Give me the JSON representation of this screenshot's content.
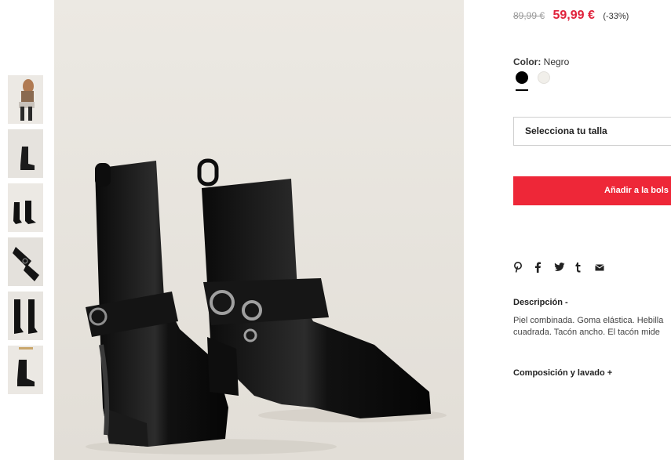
{
  "product": {
    "old_price": "89,99 €",
    "new_price": "59,99 €",
    "discount": "(-33%)",
    "color_label": "Color:",
    "color_value": "Negro",
    "swatches": [
      "Negro",
      "Blanco"
    ],
    "size_placeholder": "Selecciona tu talla",
    "add_to_bag": "Añadir a la bols",
    "share_icons": [
      "pinterest-icon",
      "facebook-icon",
      "twitter-icon",
      "tumblr-icon",
      "email-icon"
    ],
    "description_title": "Descripción -",
    "description_line1": "Piel combinada. Goma elástica. Hebilla",
    "description_line2": "cuadrada. Tacón ancho. El tacón mide",
    "composition_title": "Composición y lavado +"
  },
  "colors": {
    "accent_red": "#ee2738",
    "price_red": "#e0223b",
    "swatch_black": "#000000",
    "swatch_white": "#f1efea"
  },
  "gallery": {
    "thumbnail_count": 6
  }
}
